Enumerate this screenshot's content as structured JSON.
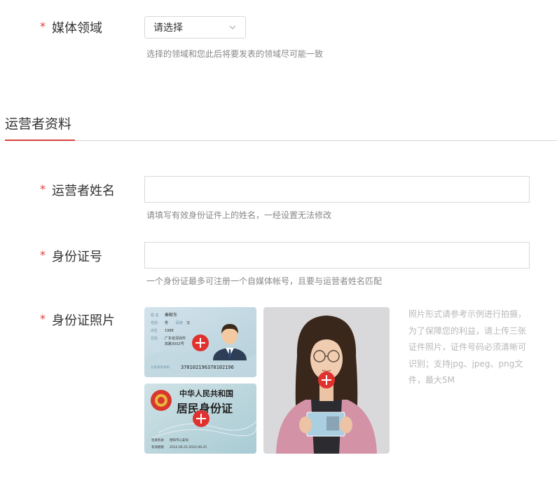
{
  "media_field": {
    "required_mark": "*",
    "label": "媒体领域",
    "select_value": "请选择",
    "hint": "选择的领域和您此后将要发表的领域尽可能一致"
  },
  "section": {
    "title": "运营者资料"
  },
  "operator_name": {
    "required_mark": "*",
    "label": "运营者姓名",
    "value": "",
    "hint": "请填写有效身份证件上的姓名，一经设置无法修改"
  },
  "id_number": {
    "required_mark": "*",
    "label": "身份证号",
    "value": "",
    "hint": "一个身份证最多可注册一个自媒体帐号，且要与运营者姓名匹配"
  },
  "id_photos": {
    "required_mark": "*",
    "label": "身份证照片",
    "front": {
      "name_value": "秦献东",
      "sex_label": "性别",
      "sex_value": "男",
      "ethnic_label": "民族",
      "ethnic_value": "汉",
      "birth_label": "出生",
      "birth_value": "1988",
      "address_label": "住址",
      "address_value_1": "广东省深圳市",
      "address_value_2": "高路3002号",
      "id_label": "公民身份号码",
      "id_value": "370102196370102196"
    },
    "back": {
      "country": "中华人民共和国",
      "card_title": "居民身份证",
      "authority_label": "签发机关",
      "authority_value": "德阳市公安局",
      "validity_label": "有效期限",
      "validity_value": "2012.06.25-2022.06.25"
    },
    "tip": "照片形式请参考示例进行拍摄，为了保障您的利益，请上传三张证件照片，证件号码必须清晰可识别；支持jpg、jpeg、png文件，最大5M"
  },
  "colors": {
    "accent_red": "#e0312f",
    "required_red": "#e23c3c"
  }
}
